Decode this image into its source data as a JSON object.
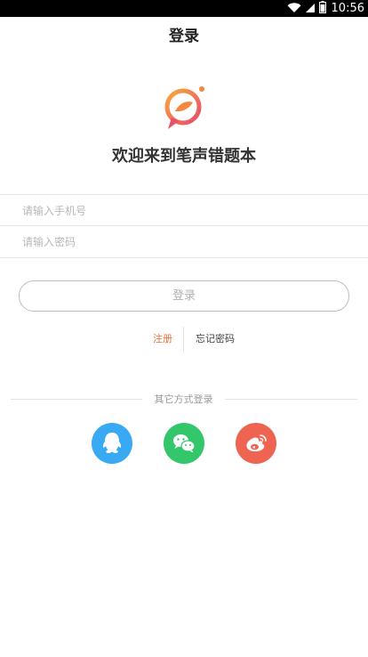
{
  "status_bar": {
    "time": "10:56",
    "icons": [
      "wifi-icon",
      "signal-icon",
      "battery-icon"
    ]
  },
  "header": {
    "title": "登录"
  },
  "brand": {
    "logo_icon": "speech-bubble-pen-logo",
    "welcome": "欢迎来到笔声错题本",
    "colors": {
      "orange": "#f49b3a",
      "pink": "#e94f6a"
    }
  },
  "form": {
    "phone_placeholder": "请输入手机号",
    "phone_value": "",
    "password_placeholder": "请输入密码",
    "password_value": "",
    "login_label": "登录"
  },
  "links": {
    "register": "注册",
    "forgot_password": "忘记密码"
  },
  "colors": {
    "accent": "#e8703c",
    "qq": "#3aa9f4",
    "wechat": "#33c66b",
    "weibo": "#ef6450"
  },
  "other_login": {
    "label": "其它方式登录",
    "providers": [
      {
        "name": "qq",
        "icon": "qq-penguin-icon"
      },
      {
        "name": "wechat",
        "icon": "wechat-icon"
      },
      {
        "name": "weibo",
        "icon": "weibo-icon"
      }
    ]
  }
}
